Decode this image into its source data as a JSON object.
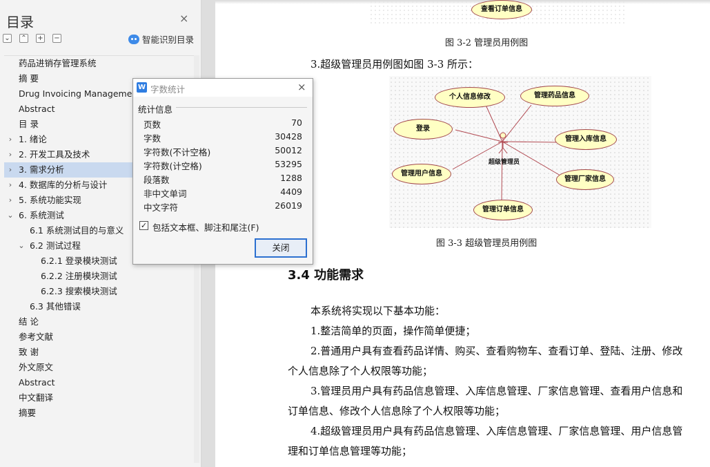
{
  "toc": {
    "title": "目录",
    "close_glyph": "×",
    "toolbar": [
      "⌄",
      "⌃",
      "+",
      "−"
    ],
    "smart_toc_label": "智能识别目录",
    "items": [
      {
        "label": "药品进销存管理系统",
        "level": 0,
        "arrow": ""
      },
      {
        "label": "摘 要",
        "level": 0,
        "arrow": ""
      },
      {
        "label": "Drug Invoicing Management",
        "level": 0,
        "arrow": ""
      },
      {
        "label": "Abstract",
        "level": 0,
        "arrow": ""
      },
      {
        "label": "目 录",
        "level": 0,
        "arrow": ""
      },
      {
        "label": "1. 绪论",
        "level": 0,
        "arrow": "›"
      },
      {
        "label": "2. 开发工具及技术",
        "level": 0,
        "arrow": "›"
      },
      {
        "label": "3. 需求分析",
        "level": 0,
        "arrow": "›",
        "selected": true
      },
      {
        "label": "4. 数据库的分析与设计",
        "level": 0,
        "arrow": "›"
      },
      {
        "label": "5. 系统功能实现",
        "level": 0,
        "arrow": "›"
      },
      {
        "label": "6. 系统测试",
        "level": 0,
        "arrow": "⌄"
      },
      {
        "label": "6.1 系统测试目的与意义",
        "level": 1,
        "arrow": ""
      },
      {
        "label": "6.2 测试过程",
        "level": 1,
        "arrow": "⌄"
      },
      {
        "label": "6.2.1 登录模块测试",
        "level": 2,
        "arrow": ""
      },
      {
        "label": "6.2.2 注册模块测试",
        "level": 2,
        "arrow": ""
      },
      {
        "label": "6.2.3 搜索模块测试",
        "level": 2,
        "arrow": ""
      },
      {
        "label": "6.3 其他错误",
        "level": 1,
        "arrow": ""
      },
      {
        "label": "结 论",
        "level": 0,
        "arrow": ""
      },
      {
        "label": "参考文献",
        "level": 0,
        "arrow": ""
      },
      {
        "label": "致 谢",
        "level": 0,
        "arrow": ""
      },
      {
        "label": "外文原文",
        "level": 0,
        "arrow": ""
      },
      {
        "label": "Abstract",
        "level": 0,
        "arrow": ""
      },
      {
        "label": "中文翻译",
        "level": 0,
        "arrow": ""
      },
      {
        "label": "摘要",
        "level": 0,
        "arrow": ""
      }
    ]
  },
  "document": {
    "top_use_case": "查看订单信息",
    "caption_3_2": "图 3-2 管理员用例图",
    "intro_3_3": "3.超级管理员用例图如图 3-3 所示：",
    "diagram": {
      "actor": "超级管理员",
      "use_cases": [
        "个人信息修改",
        "管理药品信息",
        "登录",
        "管理入库信息",
        "管理用户信息",
        "管理厂家信息",
        "管理订单信息"
      ]
    },
    "caption_3_3": "图 3-3 超级管理员用例图",
    "section_heading": "3.4 功能需求",
    "paragraphs": [
      "本系统将实现以下基本功能：",
      "1.整洁简单的页面，操作简单便捷；",
      "2.普通用户具有查看药品详情、购买、查看购物车、查看订单、登陆、注册、修改",
      "个人信息除了个人权限等功能；",
      "3.管理员用户具有药品信息管理、入库信息管理、厂家信息管理、查看用户信息和",
      "订单信息、修改个人信息除了个人权限等功能；",
      "4.超级管理员用户具有药品信息管理、入库信息管理、厂家信息管理、用户信息管",
      "理和订单信息管理等功能；"
    ]
  },
  "dialog": {
    "app_icon": "W",
    "title": "字数统计",
    "close_glyph": "×",
    "section": "统计信息",
    "stats": [
      {
        "label": "页数",
        "value": "70"
      },
      {
        "label": "字数",
        "value": "30428"
      },
      {
        "label": "字符数(不计空格)",
        "value": "50012"
      },
      {
        "label": "字符数(计空格)",
        "value": "53295"
      },
      {
        "label": "段落数",
        "value": "1288"
      },
      {
        "label": "非中文单词",
        "value": "4409"
      },
      {
        "label": "中文字符",
        "value": "26019"
      }
    ],
    "checkbox_label": "包括文本框、脚注和尾注(F)",
    "checkbox_checked": true,
    "checkbox_glyph": "✓",
    "close_button": "关闭"
  }
}
